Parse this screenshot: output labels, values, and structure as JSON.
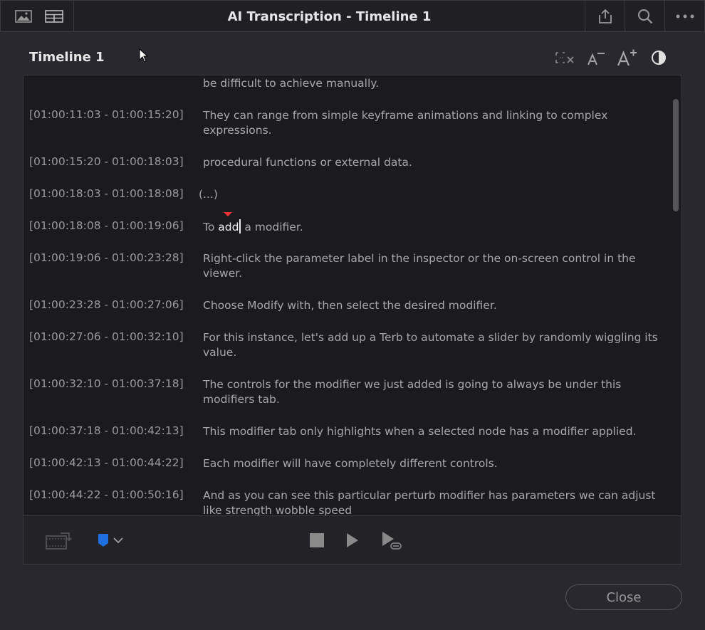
{
  "window": {
    "title": "AI Transcription - Timeline 1"
  },
  "header": {
    "title": "Timeline 1"
  },
  "transcript": [
    {
      "timecode": "",
      "text": "be difficult to achieve manually."
    },
    {
      "timecode": "[01:00:11:03 - 01:00:15:20]",
      "text": "They can range from simple keyframe animations and linking to complex expressions."
    },
    {
      "timecode": "[01:00:15:20 - 01:00:18:03]",
      "text": "procedural functions or external data."
    },
    {
      "timecode": "[01:00:18:03 - 01:00:18:08]",
      "text": "(...)"
    },
    {
      "timecode": "[01:00:18:08 - 01:00:19:06]",
      "text_before": "To ",
      "text_active": "add",
      "text_after": " a modifier."
    },
    {
      "timecode": "[01:00:19:06 - 01:00:23:28]",
      "text": "Right-click the parameter label in the inspector or the on-screen control in the viewer."
    },
    {
      "timecode": "[01:00:23:28 - 01:00:27:06]",
      "text": "Choose Modify with, then select the desired modifier."
    },
    {
      "timecode": "[01:00:27:06 - 01:00:32:10]",
      "text": "For this instance, let's add up a Terb to automate a slider by randomly wiggling its value."
    },
    {
      "timecode": "[01:00:32:10 - 01:00:37:18]",
      "text": "The controls for the modifier we just added is going to always be under this modifiers tab."
    },
    {
      "timecode": "[01:00:37:18 - 01:00:42:13]",
      "text": "This modifier tab only highlights when a selected node has a modifier applied."
    },
    {
      "timecode": "[01:00:42:13 - 01:00:44:22]",
      "text": "Each modifier will have completely different controls."
    },
    {
      "timecode": "[01:00:44:22 - 01:00:50:16]",
      "text": "And as you can see this particular perturb modifier has parameters we can adjust like strength wobble speed"
    }
  ],
  "footer": {
    "close_label": "Close"
  },
  "colors": {
    "marker_blue": "#1e6fe0",
    "playhead_red": "#e33333"
  }
}
